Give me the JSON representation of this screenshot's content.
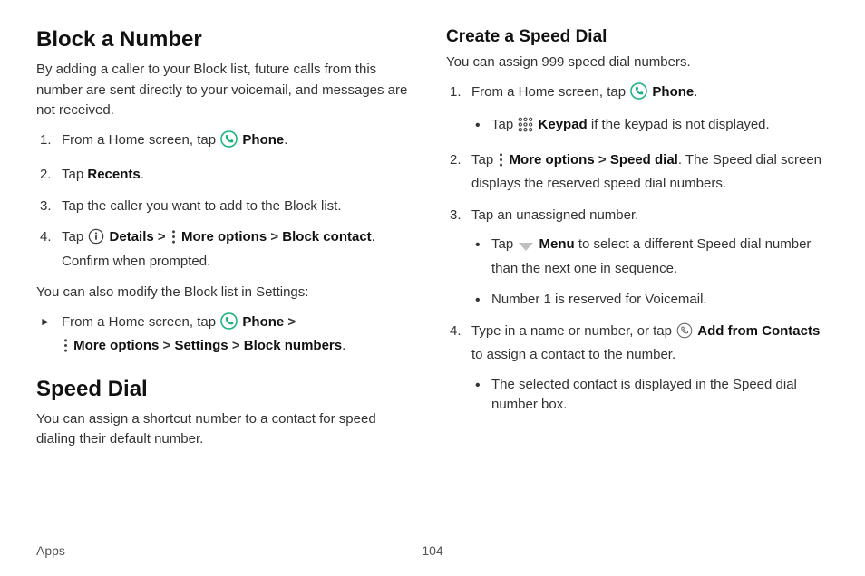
{
  "left": {
    "h1": "Block a Number",
    "intro": "By adding a caller to your Block list, future calls from this number are sent directly to your voicemail, and messages are not received.",
    "s1_pre": "From a Home screen, tap ",
    "s1_post": ".",
    "phone_label": "Phone",
    "s2_pre": "Tap ",
    "s2_bold": "Recents",
    "s2_post": ".",
    "s3": "Tap the caller you want to add to the Block list.",
    "s4_pre": "Tap ",
    "details": "Details",
    "more_options": "More options",
    "block_contact": "Block contact",
    "s4_post": ". Confirm when prompted.",
    "also": "You can also modify the Block list in Settings:",
    "alt_pre": "From a Home screen, tap ",
    "settings": "Settings",
    "block_numbers": "Block numbers",
    "h2": "Speed Dial",
    "sd_intro": "You can assign a shortcut number to a contact for speed dialing their default number."
  },
  "right": {
    "h2": "Create a Speed Dial",
    "intro": "You can assign 999 speed dial numbers.",
    "s1_pre": "From a Home screen, tap ",
    "phone_label": "Phone",
    "s1_post": ".",
    "s1b_pre": "Tap ",
    "keypad": "Keypad",
    "s1b_post": " if the keypad is not displayed.",
    "s2_pre": "Tap ",
    "more_options": "More options",
    "speed_dial": "Speed dial",
    "s2_post": ". The Speed dial screen displays the reserved speed dial numbers.",
    "s3": "Tap an unassigned number.",
    "s3b_pre": "Tap ",
    "menu": "Menu",
    "s3b_post": " to select a different Speed dial number than the next one in sequence.",
    "s3c": "Number 1 is reserved for Voicemail.",
    "s4_pre": "Type in a name or number, or tap ",
    "add_from_contacts": "Add from Contacts",
    "s4_post": " to assign a contact to the number.",
    "s4b": "The selected contact is displayed in the Speed dial number box."
  },
  "footer": {
    "section": "Apps",
    "page": "104"
  },
  "chev": ">"
}
